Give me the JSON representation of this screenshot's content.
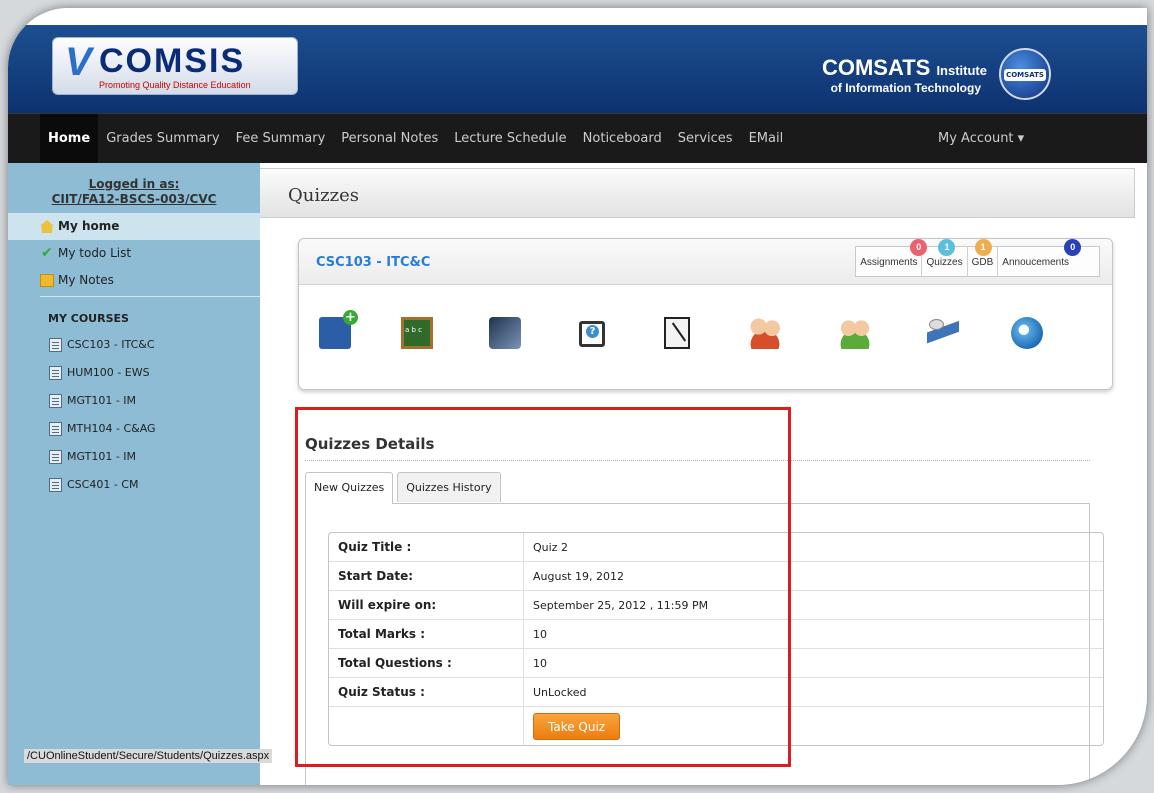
{
  "header": {
    "logo_text": "VCOMSIS",
    "logo_v": "V",
    "logo_word": "COMSIS",
    "logo_tagline": "Promoting Quality Distance Education",
    "institute_name": "COMSATS",
    "institute_word": "Institute",
    "institute_sub": "of Information Technology",
    "seal_text": "COMSATS"
  },
  "nav": {
    "items": [
      {
        "label": "Home"
      },
      {
        "label": "Grades Summary"
      },
      {
        "label": "Fee Summary"
      },
      {
        "label": "Personal Notes"
      },
      {
        "label": "Lecture Schedule"
      },
      {
        "label": "Noticeboard"
      },
      {
        "label": "Services"
      },
      {
        "label": "EMail"
      }
    ],
    "my_account": "My Account ▾"
  },
  "sidebar": {
    "logged_in_label": "Logged in as:",
    "user_id": "CIIT/FA12-BSCS-003/CVC",
    "links": [
      {
        "label": "My home"
      },
      {
        "label": "My todo List"
      },
      {
        "label": "My Notes"
      }
    ],
    "courses_heading": "MY COURSES",
    "courses": [
      {
        "label": "CSC103 - ITC&C"
      },
      {
        "label": "HUM100 - EWS"
      },
      {
        "label": "MGT101 - IM"
      },
      {
        "label": "MTH104 - C&AG"
      },
      {
        "label": "MGT101 - IM"
      },
      {
        "label": "CSC401 - CM"
      }
    ]
  },
  "status_url": "/CUOnlineStudent/Secure/Students/Quizzes.aspx",
  "main": {
    "title": "Quizzes",
    "course_code": "CSC103 - ITC&C",
    "counts": [
      {
        "label": "Assignments",
        "value": "0",
        "color": "#e8636f"
      },
      {
        "label": "Quizzes",
        "value": "1",
        "color": "#5bc0de"
      },
      {
        "label": "GDB",
        "value": "1",
        "color": "#f0ad4e"
      },
      {
        "label": "Annoucements",
        "value": "0",
        "color": "#2a3fb8"
      }
    ],
    "tool_icons": [
      "add-book-icon",
      "blackboard-icon",
      "video-icon",
      "help-icon",
      "notes-icon",
      "group-icon",
      "users-icon",
      "satellite-icon",
      "webcam-icon"
    ],
    "details_title": "Quizzes Details",
    "tabs": [
      {
        "label": "New Quizzes"
      },
      {
        "label": "Quizzes History"
      }
    ],
    "quiz": {
      "rows": [
        {
          "label": "Quiz Title :",
          "value": "Quiz 2"
        },
        {
          "label": "Start Date:",
          "value": "August 19, 2012"
        },
        {
          "label": "Will expire on:",
          "value": "September 25, 2012 , 11:59 PM"
        },
        {
          "label": "Total Marks :",
          "value": "10"
        },
        {
          "label": "Total Questions :",
          "value": "10"
        },
        {
          "label": "Quiz Status :",
          "value": "UnLocked"
        }
      ],
      "button": "Take Quiz"
    }
  }
}
